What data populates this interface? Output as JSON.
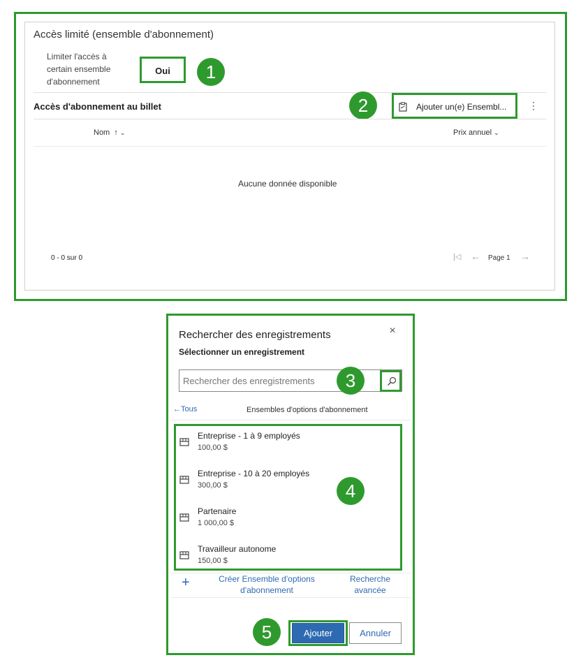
{
  "panel": {
    "title": "Accès limité (ensemble d'abonnement)",
    "limit_label_line1": "Limiter l'accès à",
    "limit_label_line2": "certain ensemble",
    "limit_label_line3": "d'abonnement",
    "limit_value": "Oui",
    "subgrid_title": "Accès d'abonnement au billet",
    "add_button": "Ajouter un(e) Ensembl...",
    "columns": {
      "name": "Nom",
      "annual_price": "Prix annuel"
    },
    "empty_message": "Aucune donnée disponible",
    "record_count": "0 - 0 sur 0",
    "page_label": "Page 1"
  },
  "dialog": {
    "title": "Rechercher des enregistrements",
    "subtitle": "Sélectionner un enregistrement",
    "search_placeholder": "Rechercher des enregistrements",
    "back_label": "Tous",
    "section_title": "Ensembles d'options d'abonnement",
    "records": [
      {
        "name": "Entreprise - 1 à 9 employés",
        "price": "100,00 $"
      },
      {
        "name": "Entreprise - 10 à 20 employés",
        "price": "300,00 $"
      },
      {
        "name": "Partenaire",
        "price": "1 000,00 $"
      },
      {
        "name": "Travailleur autonome",
        "price": "150,00 $"
      }
    ],
    "create_line1": "Créer Ensemble d'options",
    "create_line2": "d'abonnement",
    "advanced_line1": "Recherche",
    "advanced_line2": "avancée",
    "add_button": "Ajouter",
    "cancel_button": "Annuler"
  },
  "callouts": {
    "c1": "1",
    "c2": "2",
    "c3": "3",
    "c4": "4",
    "c5": "5"
  },
  "colors": {
    "highlight_green": "#2e9a2e",
    "primary_blue": "#2e6ab1"
  }
}
